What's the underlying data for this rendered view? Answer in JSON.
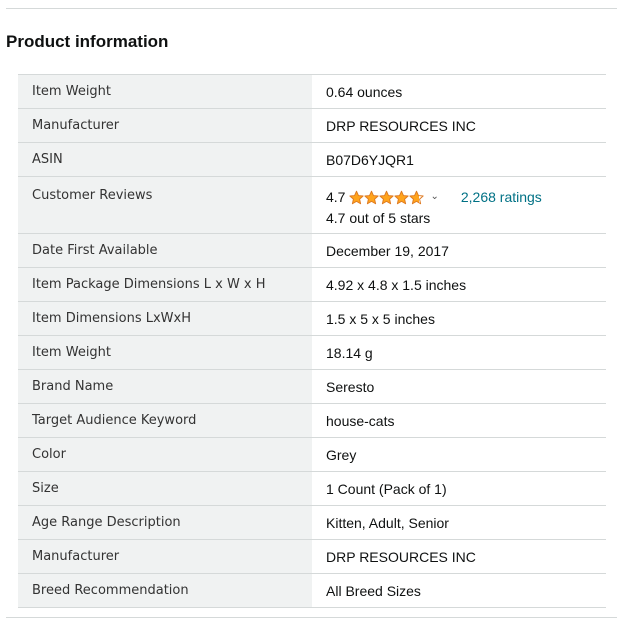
{
  "section": {
    "title": "Product information"
  },
  "rows": [
    {
      "label": "Item Weight",
      "value": "0.64 ounces"
    },
    {
      "label": "Manufacturer",
      "value": "DRP RESOURCES INC"
    },
    {
      "label": "ASIN",
      "value": "B07D6YJQR1"
    },
    {
      "label": "Customer Reviews",
      "value": ""
    },
    {
      "label": "Date First Available",
      "value": "December 19, 2017"
    },
    {
      "label": "Item Package Dimensions L x W x H",
      "value": "4.92 x 4.8 x 1.5 inches"
    },
    {
      "label": "Item Dimensions LxWxH",
      "value": "1.5 x 5 x 5 inches"
    },
    {
      "label": "Item Weight",
      "value": "18.14 g"
    },
    {
      "label": "Brand Name",
      "value": "Seresto"
    },
    {
      "label": "Target Audience Keyword",
      "value": "house-cats"
    },
    {
      "label": "Color",
      "value": "Grey"
    },
    {
      "label": "Size",
      "value": "1 Count (Pack of 1)"
    },
    {
      "label": "Age Range Description",
      "value": "Kitten, Adult, Senior"
    },
    {
      "label": "Manufacturer",
      "value": "DRP RESOURCES INC"
    },
    {
      "label": "Breed Recommendation",
      "value": "All Breed Sizes"
    }
  ],
  "reviews": {
    "rating": "4.7",
    "stars_filled": 4.7,
    "stars_total": 5,
    "ratings_link": "2,268 ratings",
    "out_of": "4.7 out of 5 stars",
    "star_color": "#ffa41c",
    "star_outline_color": "#de7921",
    "link_color": "#007185"
  },
  "icons": {
    "star": "star-icon",
    "chevron": "chevron-down-icon"
  }
}
